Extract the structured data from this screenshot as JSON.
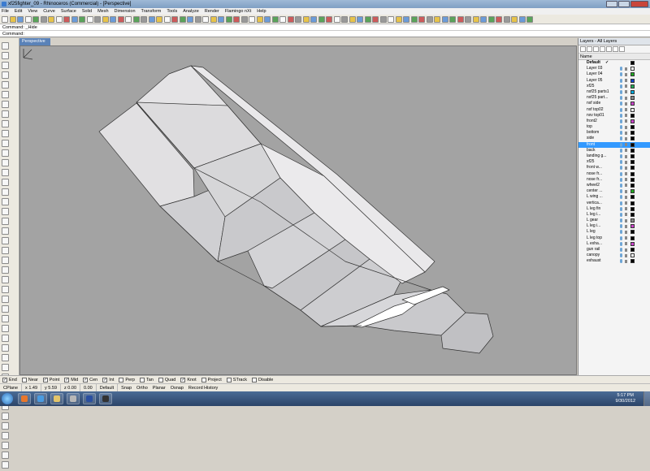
{
  "window": {
    "title": "xf25fighter_09 - Rhinoceros (Commercial) - [Perspective]"
  },
  "menu": [
    "File",
    "Edit",
    "View",
    "Curve",
    "Surface",
    "Solid",
    "Mesh",
    "Dimension",
    "Transform",
    "Tools",
    "Analyze",
    "Render",
    "Flamingo nXt",
    "Help"
  ],
  "command": {
    "history": "Command: _Hide",
    "prompt": "Command:"
  },
  "viewport": {
    "label": "Perspective",
    "background": "#a3a3a3"
  },
  "layers": {
    "title": "Layers - All Layers",
    "column_name": "Name",
    "rows": [
      {
        "name": "Default",
        "color": "#000000",
        "bold": true,
        "check": "✓"
      },
      {
        "name": "Layer 03",
        "color": "#ffffff"
      },
      {
        "name": "Layer 04",
        "color": "#22aa22"
      },
      {
        "name": "Layer 05",
        "color": "#1144cc"
      },
      {
        "name": "xf25",
        "color": "#22aa55"
      },
      {
        "name": "nxf25 parts1",
        "color": "#00aadd"
      },
      {
        "name": "nxf25 part...",
        "color": "#888888"
      },
      {
        "name": "nxf side",
        "color": "#cc44cc"
      },
      {
        "name": "nxf top02",
        "color": "#ffffff"
      },
      {
        "name": "nxv top01",
        "color": "#000000"
      },
      {
        "name": "front2",
        "color": "#cc44cc"
      },
      {
        "name": "top",
        "color": "#000000"
      },
      {
        "name": "bottom",
        "color": "#000000"
      },
      {
        "name": "side",
        "color": "#000000"
      },
      {
        "name": "front",
        "color": "#000000",
        "selected": true
      },
      {
        "name": "back",
        "color": "#000000"
      },
      {
        "name": "landing g...",
        "color": "#000000"
      },
      {
        "name": "xf25",
        "color": "#000000"
      },
      {
        "name": "front w...",
        "color": "#000000"
      },
      {
        "name": "nose fr...",
        "color": "#000000"
      },
      {
        "name": "nose fr...",
        "color": "#000000"
      },
      {
        "name": "wheel2",
        "color": "#000000"
      },
      {
        "name": "center ...",
        "color": "#22aa22"
      },
      {
        "name": "L wing ...",
        "color": "#000000"
      },
      {
        "name": "vertica...",
        "color": "#000000"
      },
      {
        "name": "L leg fin",
        "color": "#000000"
      },
      {
        "name": "L leg i...",
        "color": "#000000"
      },
      {
        "name": "L gear",
        "color": "#888888"
      },
      {
        "name": "L leg i...",
        "color": "#cc44cc"
      },
      {
        "name": "L leg",
        "color": "#000000"
      },
      {
        "name": "L leg top",
        "color": "#000000"
      },
      {
        "name": "L exha...",
        "color": "#cc44cc"
      },
      {
        "name": "gun rail",
        "color": "#000000"
      },
      {
        "name": "canopy",
        "color": "#ffffff"
      },
      {
        "name": "exhaust",
        "color": "#000000"
      }
    ]
  },
  "snaps": [
    {
      "label": "End",
      "checked": true
    },
    {
      "label": "Near",
      "checked": false
    },
    {
      "label": "Point",
      "checked": true
    },
    {
      "label": "Mid",
      "checked": true
    },
    {
      "label": "Cen",
      "checked": true
    },
    {
      "label": "Int",
      "checked": true
    },
    {
      "label": "Perp",
      "checked": false
    },
    {
      "label": "Tan",
      "checked": false
    },
    {
      "label": "Quad",
      "checked": false
    },
    {
      "label": "Knot",
      "checked": true
    },
    {
      "label": "Project",
      "checked": false
    },
    {
      "label": "STrack",
      "checked": false
    },
    {
      "label": "Disable",
      "checked": false
    }
  ],
  "status": {
    "cplane": "CPlane",
    "x": "x 1.49",
    "y": "y 5.59",
    "z": "z 0.00",
    "dist": "0.00",
    "layer": "Default",
    "toggles": [
      "Snap",
      "Ortho",
      "Planar",
      "Osnap",
      "Record History"
    ]
  },
  "taskbar": {
    "time": "5:17 PM",
    "date": "9/30/2012"
  },
  "icons": [
    "start-orb-icon",
    "firefox-icon",
    "chrome-icon",
    "explorer-icon",
    "rhino-icon",
    "photoshop-icon",
    "steam-icon"
  ]
}
